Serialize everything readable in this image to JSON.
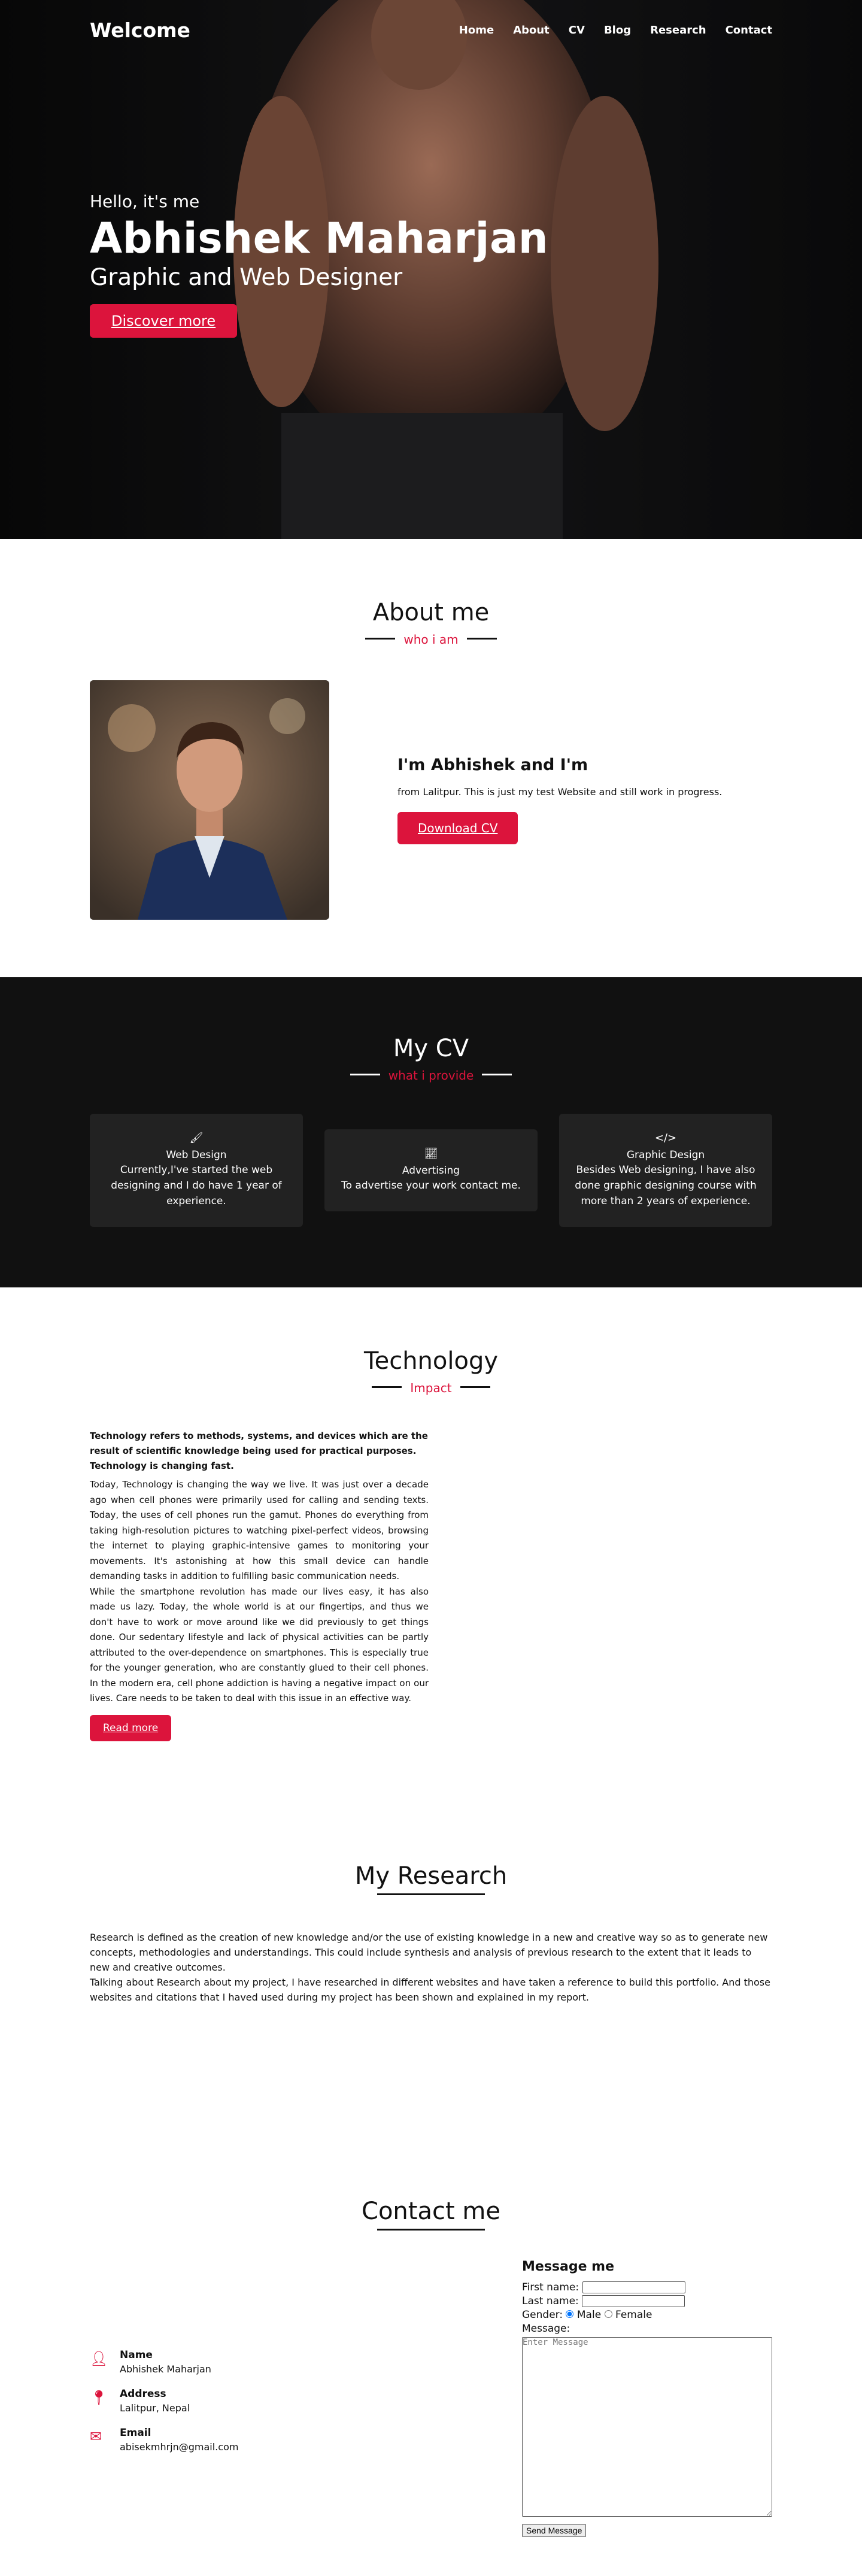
{
  "nav": {
    "logo": "Welcome",
    "items": [
      "Home",
      "About",
      "CV",
      "Blog",
      "Research",
      "Contact"
    ]
  },
  "hero": {
    "greeting": "Hello, it's me",
    "name": "Abhishek Maharjan",
    "role": "Graphic and Web Designer",
    "cta": "Discover more"
  },
  "about": {
    "title": "About me",
    "subtitle": "who i am",
    "heading": "I'm Abhishek and I'm",
    "text": "from Lalitpur. This is just my test Website and still work in progress.",
    "button": "Download CV"
  },
  "cv": {
    "title": "My CV",
    "subtitle": "what i provide",
    "cards": [
      {
        "icon": "brush-icon",
        "name": "Web Design",
        "desc": "Currently,I've started the web designing and I do have 1 year of experience."
      },
      {
        "icon": "chart-icon",
        "name": "Advertising",
        "desc": "To advertise your work contact me."
      },
      {
        "icon": "code-icon",
        "name": "Graphic Design",
        "desc": "Besides Web designing, I have also done graphic designing course with more than 2 years of experience."
      }
    ]
  },
  "tech": {
    "title": "Technology",
    "subtitle": "Impact",
    "lead": "Technology refers to methods, systems, and devices which are the result of scientific knowledge being used for practical purposes. Technology is changing fast.",
    "para1": "Today, Technology is changing the way we live. It was just over a decade ago when cell phones were primarily used for calling and sending texts. Today, the uses of cell phones run the gamut. Phones do everything from taking high-resolution pictures to watching pixel-perfect videos, browsing the internet to playing graphic-intensive games to monitoring your movements. It's astonishing at how this small device can handle demanding tasks in addition to fulfilling basic communication needs.",
    "para2": "While the smartphone revolution has made our lives easy, it has also made us lazy. Today, the whole world is at our fingertips, and thus we don't have to work or move around like we did previously to get things done. Our sedentary lifestyle and lack of physical activities can be partly attributed to the over-dependence on smartphones. This is especially true for the younger generation, who are constantly glued to their cell phones. In the modern era, cell phone addiction is having a negative impact on our lives. Care needs to be taken to deal with this issue in an effective way.",
    "button": "Read more"
  },
  "research": {
    "title": "My Research",
    "para1": "Research is defined as the creation of new knowledge and/or the use of existing knowledge in a new and creative way so as to generate new concepts, methodologies and understandings. This could include synthesis and analysis of previous research to the extent that it leads to new and creative outcomes.",
    "para2": "Talking about Research about my project, I have researched in different websites and have taken a reference to build this portfolio. And those websites and citations that I haved used during my project has been shown and explained in my report."
  },
  "contact": {
    "title": "Contact me",
    "info": [
      {
        "icon": "user-icon",
        "label": "Name",
        "value": "Abhishek Maharjan"
      },
      {
        "icon": "location-icon",
        "label": "Address",
        "value": "Lalitpur, Nepal"
      },
      {
        "icon": "envelope-icon",
        "label": "Email",
        "value": "abisekmhrjn@gmail.com"
      }
    ],
    "form": {
      "title": "Message me",
      "first_name": "First name:",
      "last_name": "Last name:",
      "gender": "Gender:",
      "male": "Male",
      "female": "Female",
      "message": "Message:",
      "placeholder": "Enter Message",
      "send": "Send Message"
    }
  },
  "colors": {
    "accent": "#dc143c",
    "dark": "#111111",
    "card": "#222222"
  }
}
